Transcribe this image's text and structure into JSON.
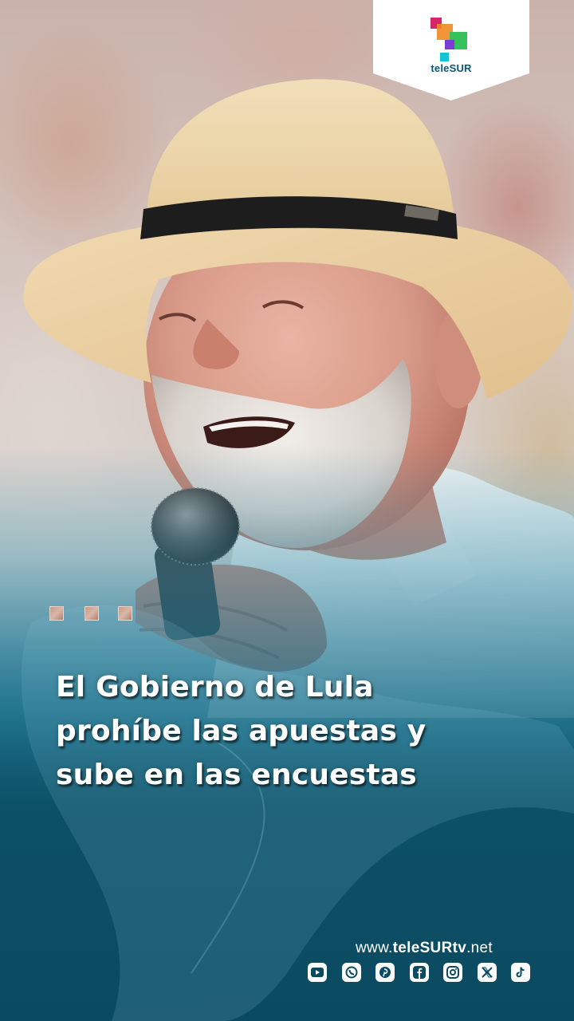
{
  "brand": {
    "logo_text": "teleSUR",
    "colors": {
      "teal_dark": "#0b4b61",
      "teal": "#13627a",
      "logo_magenta": "#d6246e",
      "logo_orange": "#f08a24",
      "logo_green": "#37c15a",
      "logo_purple": "#7a3fd1",
      "logo_cyan": "#18c2d6"
    }
  },
  "decoration": {
    "squares": [
      "square",
      "square",
      "square"
    ]
  },
  "headline": {
    "lines": [
      "El Gobierno de Lula",
      "prohíbe las apuestas y",
      "sube en las encuestas"
    ]
  },
  "footer": {
    "website_prefix": "www.",
    "website_brand": "teleSURtv",
    "website_suffix": ".net",
    "social_icons": [
      "youtube-icon",
      "whatsapp-icon",
      "pinterest-icon",
      "facebook-icon",
      "instagram-icon",
      "x-icon",
      "tiktok-icon"
    ]
  }
}
